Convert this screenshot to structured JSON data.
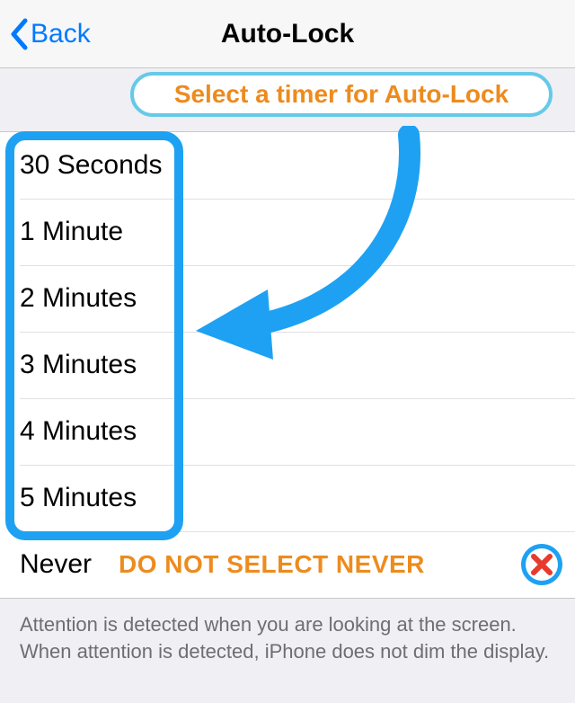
{
  "navbar": {
    "back_label": "Back",
    "title": "Auto-Lock"
  },
  "callout": {
    "text": "Select a timer for Auto-Lock"
  },
  "options": [
    "30 Seconds",
    "1 Minute",
    "2 Minutes",
    "3 Minutes",
    "4 Minutes",
    "5 Minutes"
  ],
  "never": {
    "label": "Never",
    "warning": "DO NOT SELECT NEVER"
  },
  "footer": "Attention is detected when you are looking at the screen. When attention is detected, iPhone does not dim the display."
}
